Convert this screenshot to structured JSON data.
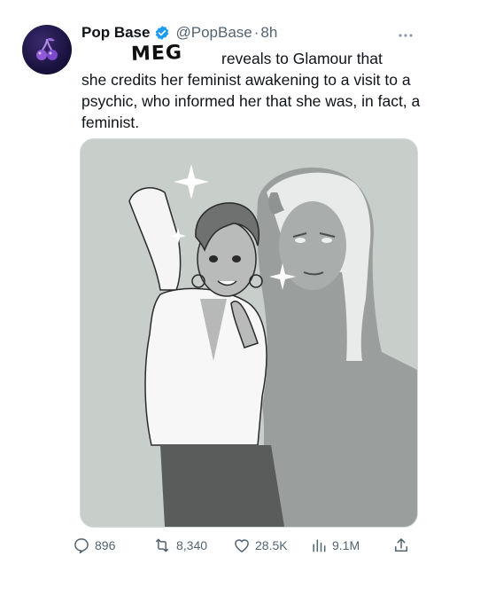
{
  "tweet": {
    "author_name": "Pop Base",
    "handle": "@PopBase",
    "separator": "·",
    "time": "8h",
    "more_icon": "more-dots-icon",
    "verified_icon": "verified-badge-icon",
    "handwritten_overlay": "MEG",
    "text_line1": "reveals to Glamour that",
    "text_rest": "she credits her feminist awakening to a visit to a psychic, who informed her that she was, in fact, a feminist."
  },
  "actions": {
    "replies": "896",
    "reposts": "8,340",
    "likes": "28.5K",
    "views": "9.1M"
  },
  "icons": [
    "reply-icon",
    "repost-icon",
    "like-icon",
    "views-icon",
    "share-icon"
  ],
  "colors": {
    "verified": "#1d9bf0",
    "secondary_text": "#536471"
  }
}
